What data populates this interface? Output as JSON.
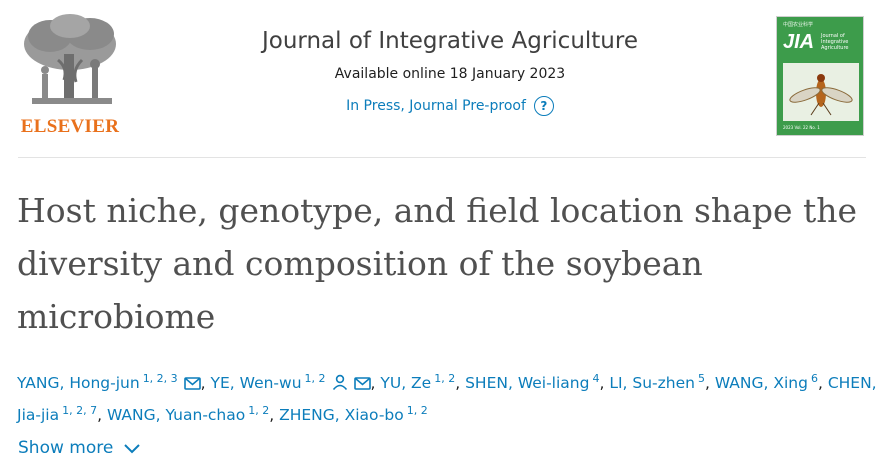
{
  "publisher": {
    "name": "ELSEVIER"
  },
  "journal": {
    "title": "Journal of Integrative Agriculture",
    "available_online": "Available online 18 January 2023",
    "status": "In Press, Journal Pre-proof",
    "help_glyph": "?"
  },
  "cover": {
    "top_text": "中国农业科学",
    "abbrev": "JIA",
    "name_line": "Journal of Integrative Agriculture",
    "foot_text": "2023 Vol. 22 No. 1"
  },
  "article": {
    "title": "Host niche, genotype, and field location shape the diversity and composition of the soybean microbiome"
  },
  "authors": [
    {
      "name": "YANG, Hong-jun",
      "sup": "1, 2, 3",
      "icons": [
        "email-icon"
      ]
    },
    {
      "name": "YE, Wen-wu",
      "sup": "1, 2",
      "icons": [
        "person-icon",
        "email-icon"
      ]
    },
    {
      "name": "YU, Ze",
      "sup": "1, 2",
      "icons": []
    },
    {
      "name": "SHEN, Wei-liang",
      "sup": "4",
      "icons": []
    },
    {
      "name": "LI, Su-zhen",
      "sup": "5",
      "icons": []
    },
    {
      "name": "WANG, Xing",
      "sup": "6",
      "icons": []
    },
    {
      "name": "CHEN, Jia-jia",
      "sup": "1, 2, 7",
      "icons": []
    },
    {
      "name": "WANG, Yuan-chao",
      "sup": "1, 2",
      "icons": []
    },
    {
      "name": "ZHENG, Xiao-bo",
      "sup": "1, 2",
      "icons": []
    }
  ],
  "show_more": {
    "label": "Show more"
  },
  "colors": {
    "link": "#0c7dbb",
    "elsevier_orange": "#e9711c",
    "cover_green": "#3d9c4b"
  }
}
